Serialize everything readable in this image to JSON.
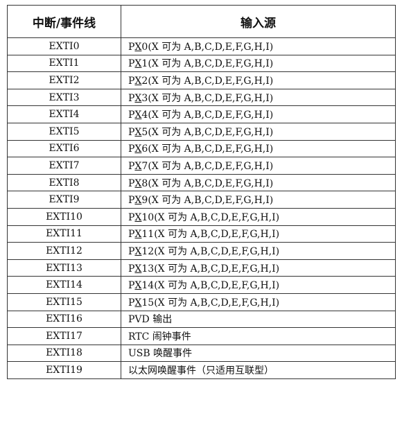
{
  "table": {
    "headers": [
      "中断/事件线",
      "输入源"
    ],
    "rows": [
      {
        "line": "EXTI0",
        "src_pre": "P",
        "src_x": "X",
        "src_num": "0",
        "src_rest": "(X 可为 A,B,C,D,E,F,G,H,I)"
      },
      {
        "line": "EXTI1",
        "src_pre": "P",
        "src_x": "X",
        "src_num": "1",
        "src_rest": "(X 可为 A,B,C,D,E,F,G,H,I)"
      },
      {
        "line": "EXTI2",
        "src_pre": "P",
        "src_x": "X",
        "src_num": "2",
        "src_rest": "(X 可为 A,B,C,D,E,F,G,H,I)"
      },
      {
        "line": "EXTI3",
        "src_pre": "P",
        "src_x": "X",
        "src_num": "3",
        "src_rest": "(X 可为 A,B,C,D,E,F,G,H,I)"
      },
      {
        "line": "EXTI4",
        "src_pre": "P",
        "src_x": "X",
        "src_num": "4",
        "src_rest": "(X 可为 A,B,C,D,E,F,G,H,I)"
      },
      {
        "line": "EXTI5",
        "src_pre": "P",
        "src_x": "X",
        "src_num": "5",
        "src_rest": "(X 可为 A,B,C,D,E,F,G,H,I)"
      },
      {
        "line": "EXTI6",
        "src_pre": "P",
        "src_x": "X",
        "src_num": "6",
        "src_rest": "(X 可为 A,B,C,D,E,F,G,H,I)"
      },
      {
        "line": "EXTI7",
        "src_pre": "P",
        "src_x": "X",
        "src_num": "7",
        "src_rest": "(X 可为 A,B,C,D,E,F,G,H,I)"
      },
      {
        "line": "EXTI8",
        "src_pre": "P",
        "src_x": "X",
        "src_num": "8",
        "src_rest": "(X 可为 A,B,C,D,E,F,G,H,I)"
      },
      {
        "line": "EXTI9",
        "src_pre": "P",
        "src_x": "X",
        "src_num": "9",
        "src_rest": "(X 可为 A,B,C,D,E,F,G,H,I)"
      },
      {
        "line": "EXTI10",
        "src_pre": "P",
        "src_x": "X",
        "src_num": "10",
        "src_rest": "(X 可为 A,B,C,D,E,F,G,H,I)"
      },
      {
        "line": "EXTI11",
        "src_pre": "P",
        "src_x": "X",
        "src_num": "11",
        "src_rest": "(X 可为 A,B,C,D,E,F,G,H,I)"
      },
      {
        "line": "EXTI12",
        "src_pre": "P",
        "src_x": "X",
        "src_num": "12",
        "src_rest": "(X 可为 A,B,C,D,E,F,G,H,I)"
      },
      {
        "line": "EXTI13",
        "src_pre": "P",
        "src_x": "X",
        "src_num": "13",
        "src_rest": "(X 可为 A,B,C,D,E,F,G,H,I)"
      },
      {
        "line": "EXTI14",
        "src_pre": "P",
        "src_x": "X",
        "src_num": "14",
        "src_rest": "(X 可为 A,B,C,D,E,F,G,H,I)"
      },
      {
        "line": "EXTI15",
        "src_pre": "P",
        "src_x": "X",
        "src_num": "15",
        "src_rest": "(X 可为 A,B,C,D,E,F,G,H,I)"
      },
      {
        "line": "EXTI16",
        "src_text": "PVD 输出"
      },
      {
        "line": "EXTI17",
        "src_text": "RTC 闹钟事件"
      },
      {
        "line": "EXTI18",
        "src_text": "USB 唤醒事件"
      },
      {
        "line": "EXTI19",
        "src_text": "以太网唤醒事件（只适用互联型）"
      }
    ]
  }
}
